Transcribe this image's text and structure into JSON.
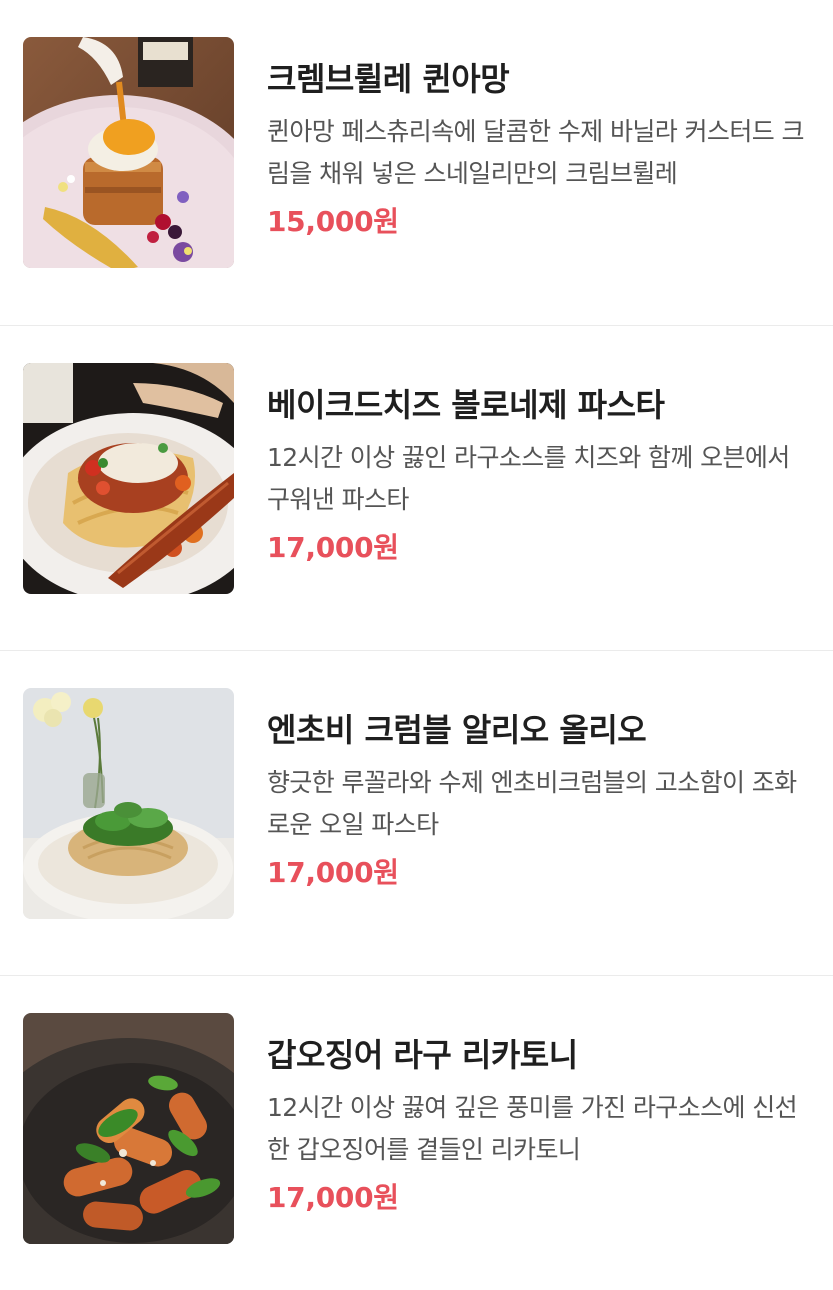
{
  "menu": {
    "items": [
      {
        "name": "크렘브륄레 퀸아망",
        "description": "퀸아망 페스츄리속에 달콤한 수제 바닐라 커스터드 크림을 채워 넣은 스네일리만의 크림브륄레",
        "price": "15,000원",
        "image_icon": "creme-brulee-kouign-amann-photo"
      },
      {
        "name": "베이크드치즈 볼로네제 파스타",
        "description": "12시간 이상 끓인 라구소스를 치즈와 함께 오븐에서 구워낸 파스타",
        "price": "17,000원",
        "image_icon": "baked-cheese-bolognese-pasta-photo"
      },
      {
        "name": "엔초비 크럼블 알리오 올리오",
        "description": "향긋한 루꼴라와 수제 엔초비크럼블의 고소함이 조화로운 오일 파스타",
        "price": "17,000원",
        "image_icon": "anchovy-aglio-olio-photo"
      },
      {
        "name": "갑오징어 라구 리카토니",
        "description": "12시간 이상 끓여 깊은 풍미를 가진 라구소스에 신선한 갑오징어를 곁들인 리카토니",
        "price": "17,000원",
        "image_icon": "cuttlefish-ragu-rigatoni-photo"
      }
    ]
  },
  "colors": {
    "price": "#e8505b",
    "title": "#1f1f1f",
    "description": "#555555",
    "divider": "#ebebeb"
  }
}
